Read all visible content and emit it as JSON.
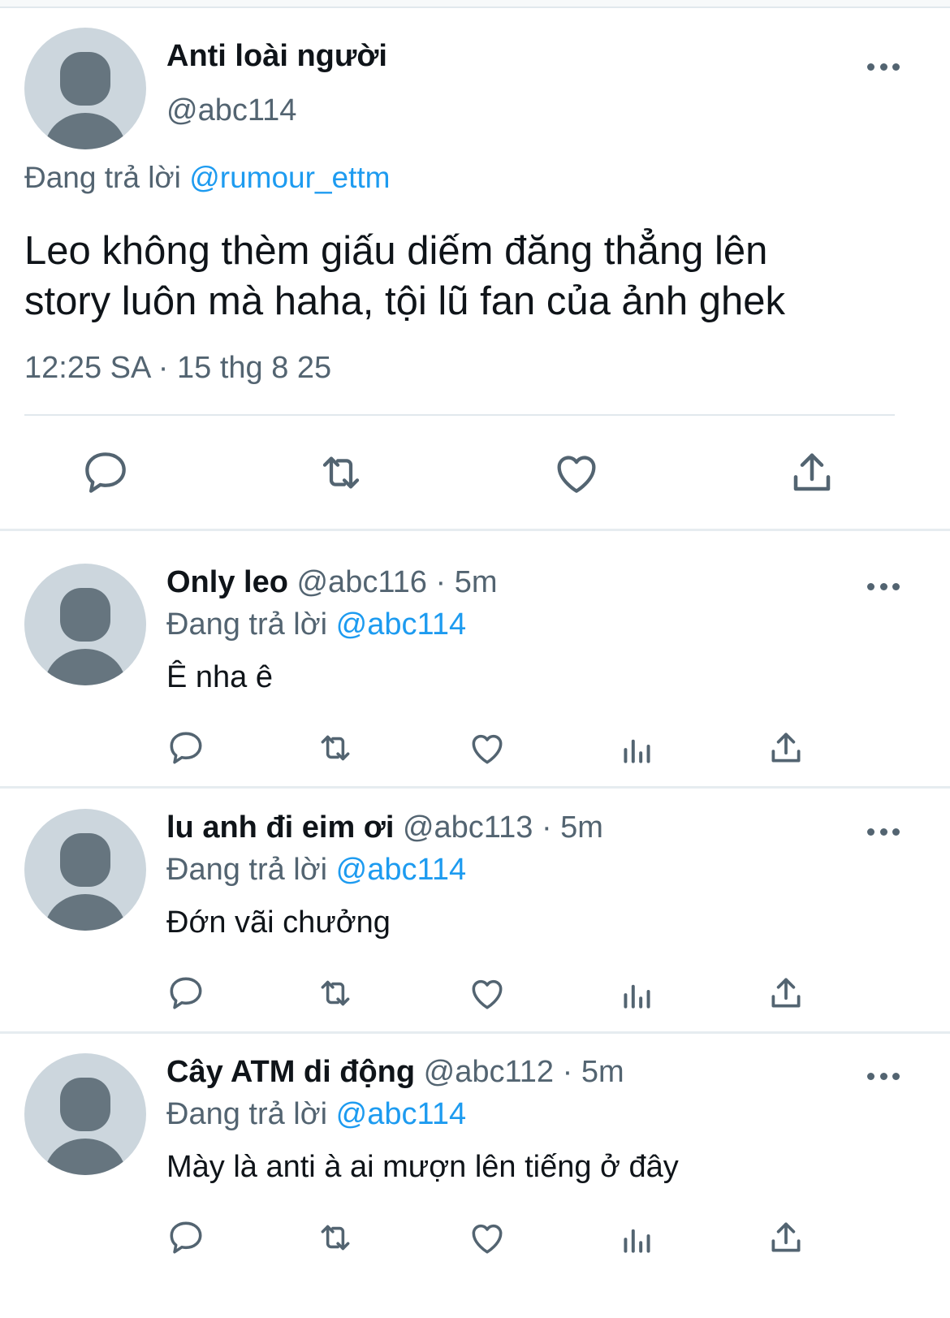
{
  "main_tweet": {
    "name": "Anti loài người",
    "handle": "@abc114",
    "replying_prefix": "Đang trả lời",
    "replying_to": "@rumour_ettm",
    "text_line1": "Leo không thèm giấu diếm đăng thẳng lên",
    "text_line2": "story luôn mà haha, tội lũ fan của ảnh ghek",
    "timestamp": "12:25 SA · 15 thg 8 25",
    "icons": [
      "comment-icon",
      "retweet-icon",
      "like-icon",
      "share-icon"
    ]
  },
  "replies": [
    {
      "name": "Only leo",
      "handle": "@abc116",
      "dot": "·",
      "time": "5m",
      "replying_prefix": "Đang trả lời",
      "replying_to": "@abc114",
      "text": "Ê nha ê"
    },
    {
      "name": "lu anh đi eim ơi",
      "handle": "@abc113",
      "dot": "·",
      "time": "5m",
      "replying_prefix": "Đang trả lời",
      "replying_to": "@abc114",
      "text": "Đớn vãi chưởng"
    },
    {
      "name": "Cây ATM di động",
      "handle": "@abc112",
      "dot": "·",
      "time": "5m",
      "replying_prefix": "Đang trả lời",
      "replying_to": "@abc114",
      "text": "Mày là anti à ai mượn lên tiếng ở đây"
    }
  ],
  "reply_icons": [
    "comment-icon",
    "retweet-icon",
    "like-icon",
    "views-icon",
    "share-icon"
  ],
  "colors": {
    "link": "#1d9bf0",
    "secondary_text": "#536471",
    "avatar_bg": "#ccd6dd",
    "avatar_figure": "#66757f"
  }
}
